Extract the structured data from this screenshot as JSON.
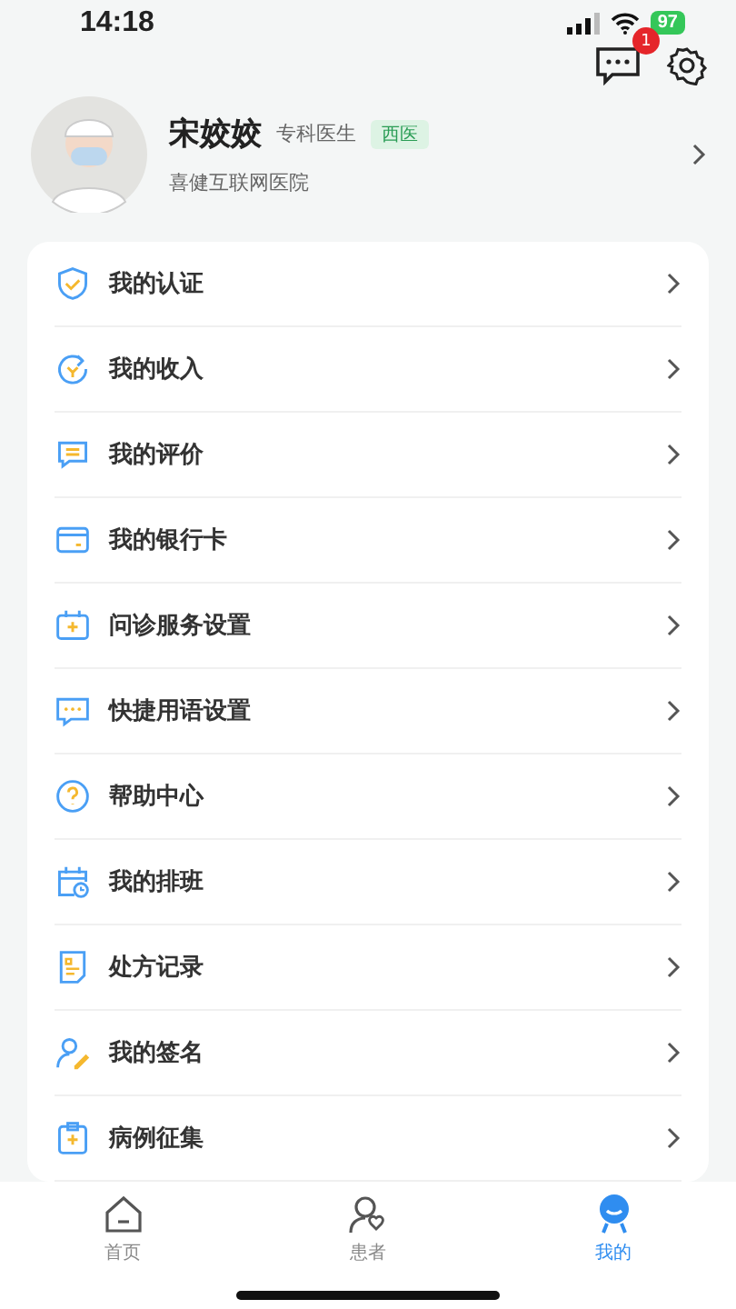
{
  "status_bar": {
    "time": "14:18",
    "battery": "97"
  },
  "header": {
    "message_badge": "1"
  },
  "profile": {
    "name": "宋姣姣",
    "title": "专科医生",
    "tag": "西医",
    "hospital": "喜健互联网医院"
  },
  "menu": [
    {
      "label": "我的认证"
    },
    {
      "label": "我的收入"
    },
    {
      "label": "我的评价"
    },
    {
      "label": "我的银行卡"
    },
    {
      "label": "问诊服务设置"
    },
    {
      "label": "快捷用语设置"
    },
    {
      "label": "帮助中心"
    },
    {
      "label": "我的排班"
    },
    {
      "label": "处方记录"
    },
    {
      "label": "我的签名"
    },
    {
      "label": "病例征集"
    }
  ],
  "tab_bar": [
    {
      "label": "首页",
      "selected": false
    },
    {
      "label": "患者",
      "selected": false
    },
    {
      "label": "我的",
      "selected": true
    }
  ]
}
